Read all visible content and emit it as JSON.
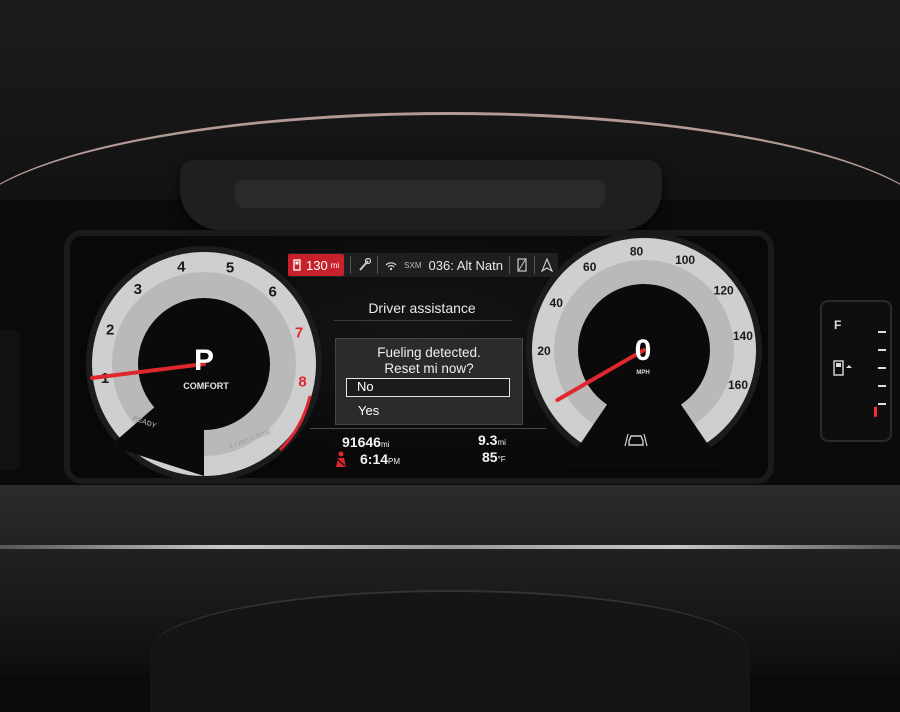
{
  "status_bar": {
    "range_value": "130",
    "range_unit": "mi",
    "sxm_label": "SXM",
    "channel": "036: Alt Natn",
    "icons": [
      "fuel-pump-icon",
      "wrench-icon",
      "satellite-radio-icon",
      "phone-signal-icon",
      "navigation-arrow-icon"
    ]
  },
  "center_panel": {
    "title": "Driver assistance",
    "dialog": {
      "line1": "Fueling detected.",
      "line2": "Reset mi now?",
      "options": [
        "No",
        "Yes"
      ],
      "selected": "No"
    }
  },
  "trip": {
    "odometer": "91646",
    "odometer_unit": "mi",
    "time": "6:14",
    "time_suffix": "PM",
    "trip_distance": "9.3",
    "trip_unit": "mi",
    "temperature": "85",
    "temperature_unit": "°F"
  },
  "tachometer": {
    "ticks": [
      "1",
      "2",
      "3",
      "4",
      "5",
      "6",
      "7",
      "8"
    ],
    "redline_ticks": [
      "7",
      "8"
    ],
    "gear": "P",
    "mode": "COMFORT",
    "ready_label": "READY",
    "unit_label": "1 / min x 1000"
  },
  "speedometer": {
    "ticks": [
      "20",
      "40",
      "60",
      "80",
      "100",
      "120",
      "140",
      "160"
    ],
    "speed": "0",
    "unit": "MPH",
    "max": 160
  },
  "fuel_gauge": {
    "full_label": "F",
    "level_fraction": 0.08
  },
  "colors": {
    "accent_red": "#c7212b",
    "needle_red": "#e0262e",
    "gauge_face": "#d7d7d7"
  }
}
